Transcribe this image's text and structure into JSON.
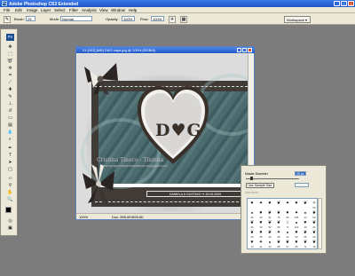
{
  "app": {
    "title": "Adobe Photoshop CS3 Extended",
    "logo": "Ps"
  },
  "menu": [
    "File",
    "Edit",
    "Image",
    "Layer",
    "Select",
    "Filter",
    "Analysis",
    "View",
    "Window",
    "Help"
  ],
  "options": {
    "brush_label": "Brush:",
    "brush_size": "25",
    "mode_label": "Mode:",
    "mode_value": "Normal",
    "opacity_label": "Opacity:",
    "opacity_value": "100%",
    "flow_label": "Flow:",
    "flow_value": "100%",
    "workspace_label": "Workspace ▾"
  },
  "toolbox": {
    "logo": "Ps"
  },
  "document": {
    "title": "01 [003] [MB] D&G capa.jpg @ 100% (RGB/8)",
    "zoom": "100%",
    "doc_info": "Doc: 895.6K/895.6K",
    "initials": "D♥G",
    "strip_text": "DANIELA & GUSTAVO ✦ 30.05.2009",
    "watermark_name": "Cristina Tinoco - Tininha",
    "watermark_url": "www.scrapbookandcreations.blogspot.com"
  },
  "brush_panel": {
    "master_diameter_label": "Master Diameter",
    "master_diameter_value": "25 px",
    "sample_size_button": "Use Sample Size",
    "hardness_label": "Hardness:",
    "brushes": [
      {
        "icon": "heart-brush-icon",
        "glyph": "♥",
        "num": ""
      },
      {
        "icon": "star-brush-icon",
        "glyph": "✦",
        "num": ""
      },
      {
        "icon": "heart-brush-icon",
        "glyph": "♥",
        "num": ""
      },
      {
        "icon": "fleur-brush-icon",
        "glyph": "❦",
        "num": ""
      },
      {
        "icon": "star-brush-icon",
        "glyph": "✦",
        "num": ""
      },
      {
        "icon": "heart-brush-icon",
        "glyph": "♥",
        "num": ""
      },
      {
        "icon": "fleur-brush-icon",
        "glyph": "❦",
        "num": ""
      },
      {
        "icon": "star-brush-icon",
        "glyph": "✧",
        "num": "60"
      },
      {
        "icon": "round-brush-icon",
        "glyph": "●",
        "num": "46"
      },
      {
        "icon": "heart-brush-icon",
        "glyph": "♥",
        "num": "23"
      },
      {
        "icon": "fleur-brush-icon",
        "glyph": "❦",
        "num": "61"
      },
      {
        "icon": "fleur-brush-icon",
        "glyph": "❦",
        "num": "75"
      },
      {
        "icon": "heart-brush-icon",
        "glyph": "♥",
        "num": "80"
      },
      {
        "icon": "star-brush-icon",
        "glyph": "✦",
        "num": "105"
      },
      {
        "icon": "round-brush-icon",
        "glyph": "●",
        "num": "24"
      },
      {
        "icon": "fleur-brush-icon",
        "glyph": "❦",
        "num": "52"
      },
      {
        "icon": "fleur-brush-icon",
        "glyph": "❦",
        "num": "36"
      },
      {
        "icon": "heart-brush-icon",
        "glyph": "♥",
        "num": "39"
      },
      {
        "icon": "fleur-brush-icon",
        "glyph": "❦",
        "num": "52"
      },
      {
        "icon": "fleur-brush-icon",
        "glyph": "❦",
        "num": "60"
      },
      {
        "icon": "star-brush-icon",
        "glyph": "☆",
        "num": "71"
      },
      {
        "icon": "round-brush-icon",
        "glyph": "●",
        "num": "100"
      },
      {
        "icon": "heart-brush-icon",
        "glyph": "♥",
        "num": "49"
      },
      {
        "icon": "fleur-brush-icon",
        "glyph": "❦",
        "num": "26"
      },
      {
        "icon": "fleur-brush-icon",
        "glyph": "❦",
        "num": "49"
      },
      {
        "icon": "heart-brush-icon",
        "glyph": "♥",
        "num": "35"
      },
      {
        "icon": "fleur-brush-icon",
        "glyph": "❦",
        "num": "46"
      },
      {
        "icon": "star-brush-icon",
        "glyph": "✦",
        "num": "59"
      },
      {
        "icon": "round-brush-icon",
        "glyph": "●",
        "num": "33"
      },
      {
        "icon": "heart-brush-icon",
        "glyph": "♥",
        "num": "53"
      },
      {
        "icon": "fleur-brush-icon",
        "glyph": "❦",
        "num": "56"
      },
      {
        "icon": "fleur-brush-icon",
        "glyph": "❦",
        "num": "62"
      },
      {
        "icon": "heart-brush-icon",
        "glyph": "♥",
        "num": "74"
      },
      {
        "icon": "star-brush-icon",
        "glyph": "✦",
        "num": "41"
      },
      {
        "icon": "round-brush-icon",
        "glyph": "●",
        "num": "43"
      },
      {
        "icon": "fleur-brush-icon",
        "glyph": "❦",
        "num": "80"
      },
      {
        "icon": "fleur-brush-icon",
        "glyph": "❦",
        "num": "57"
      },
      {
        "icon": "heart-brush-icon",
        "glyph": "♥",
        "num": "65"
      },
      {
        "icon": "fleur-brush-icon",
        "glyph": "❦",
        "num": "71"
      },
      {
        "icon": "fleur-brush-icon",
        "glyph": "❦",
        "num": "19"
      }
    ]
  }
}
